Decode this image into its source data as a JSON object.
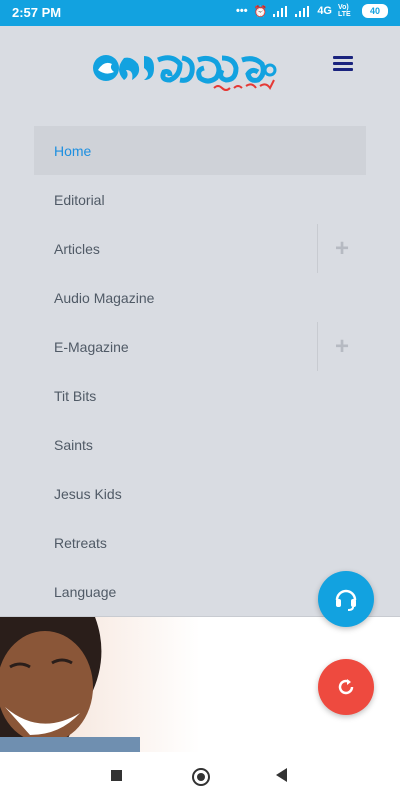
{
  "status": {
    "time": "2:57 PM",
    "network": "4G",
    "volte": "Vo) LTE",
    "battery": "40"
  },
  "header": {
    "logo_icon": "dove-icon",
    "menu_icon": "hamburger-menu-icon"
  },
  "nav": {
    "items": [
      {
        "label": "Home",
        "active": true,
        "expandable": false
      },
      {
        "label": "Editorial",
        "expandable": false
      },
      {
        "label": "Articles",
        "expandable": true
      },
      {
        "label": "Audio Magazine",
        "expandable": false
      },
      {
        "label": "E-Magazine",
        "expandable": true
      },
      {
        "label": "Tit Bits",
        "expandable": false
      },
      {
        "label": "Saints",
        "expandable": false
      },
      {
        "label": "Jesus Kids",
        "expandable": false
      },
      {
        "label": "Retreats",
        "expandable": false
      },
      {
        "label": "Language",
        "expandable": false
      }
    ],
    "expand_symbol": "+"
  },
  "fabs": {
    "support_icon": "headset-icon",
    "refresh_icon": "refresh-icon"
  },
  "colors": {
    "status_bar": "#12a2e0",
    "accent": "#1d8fe0",
    "menu_icon": "#1a237e",
    "fab_support": "#12a2e0",
    "fab_refresh": "#ee4a3f"
  }
}
